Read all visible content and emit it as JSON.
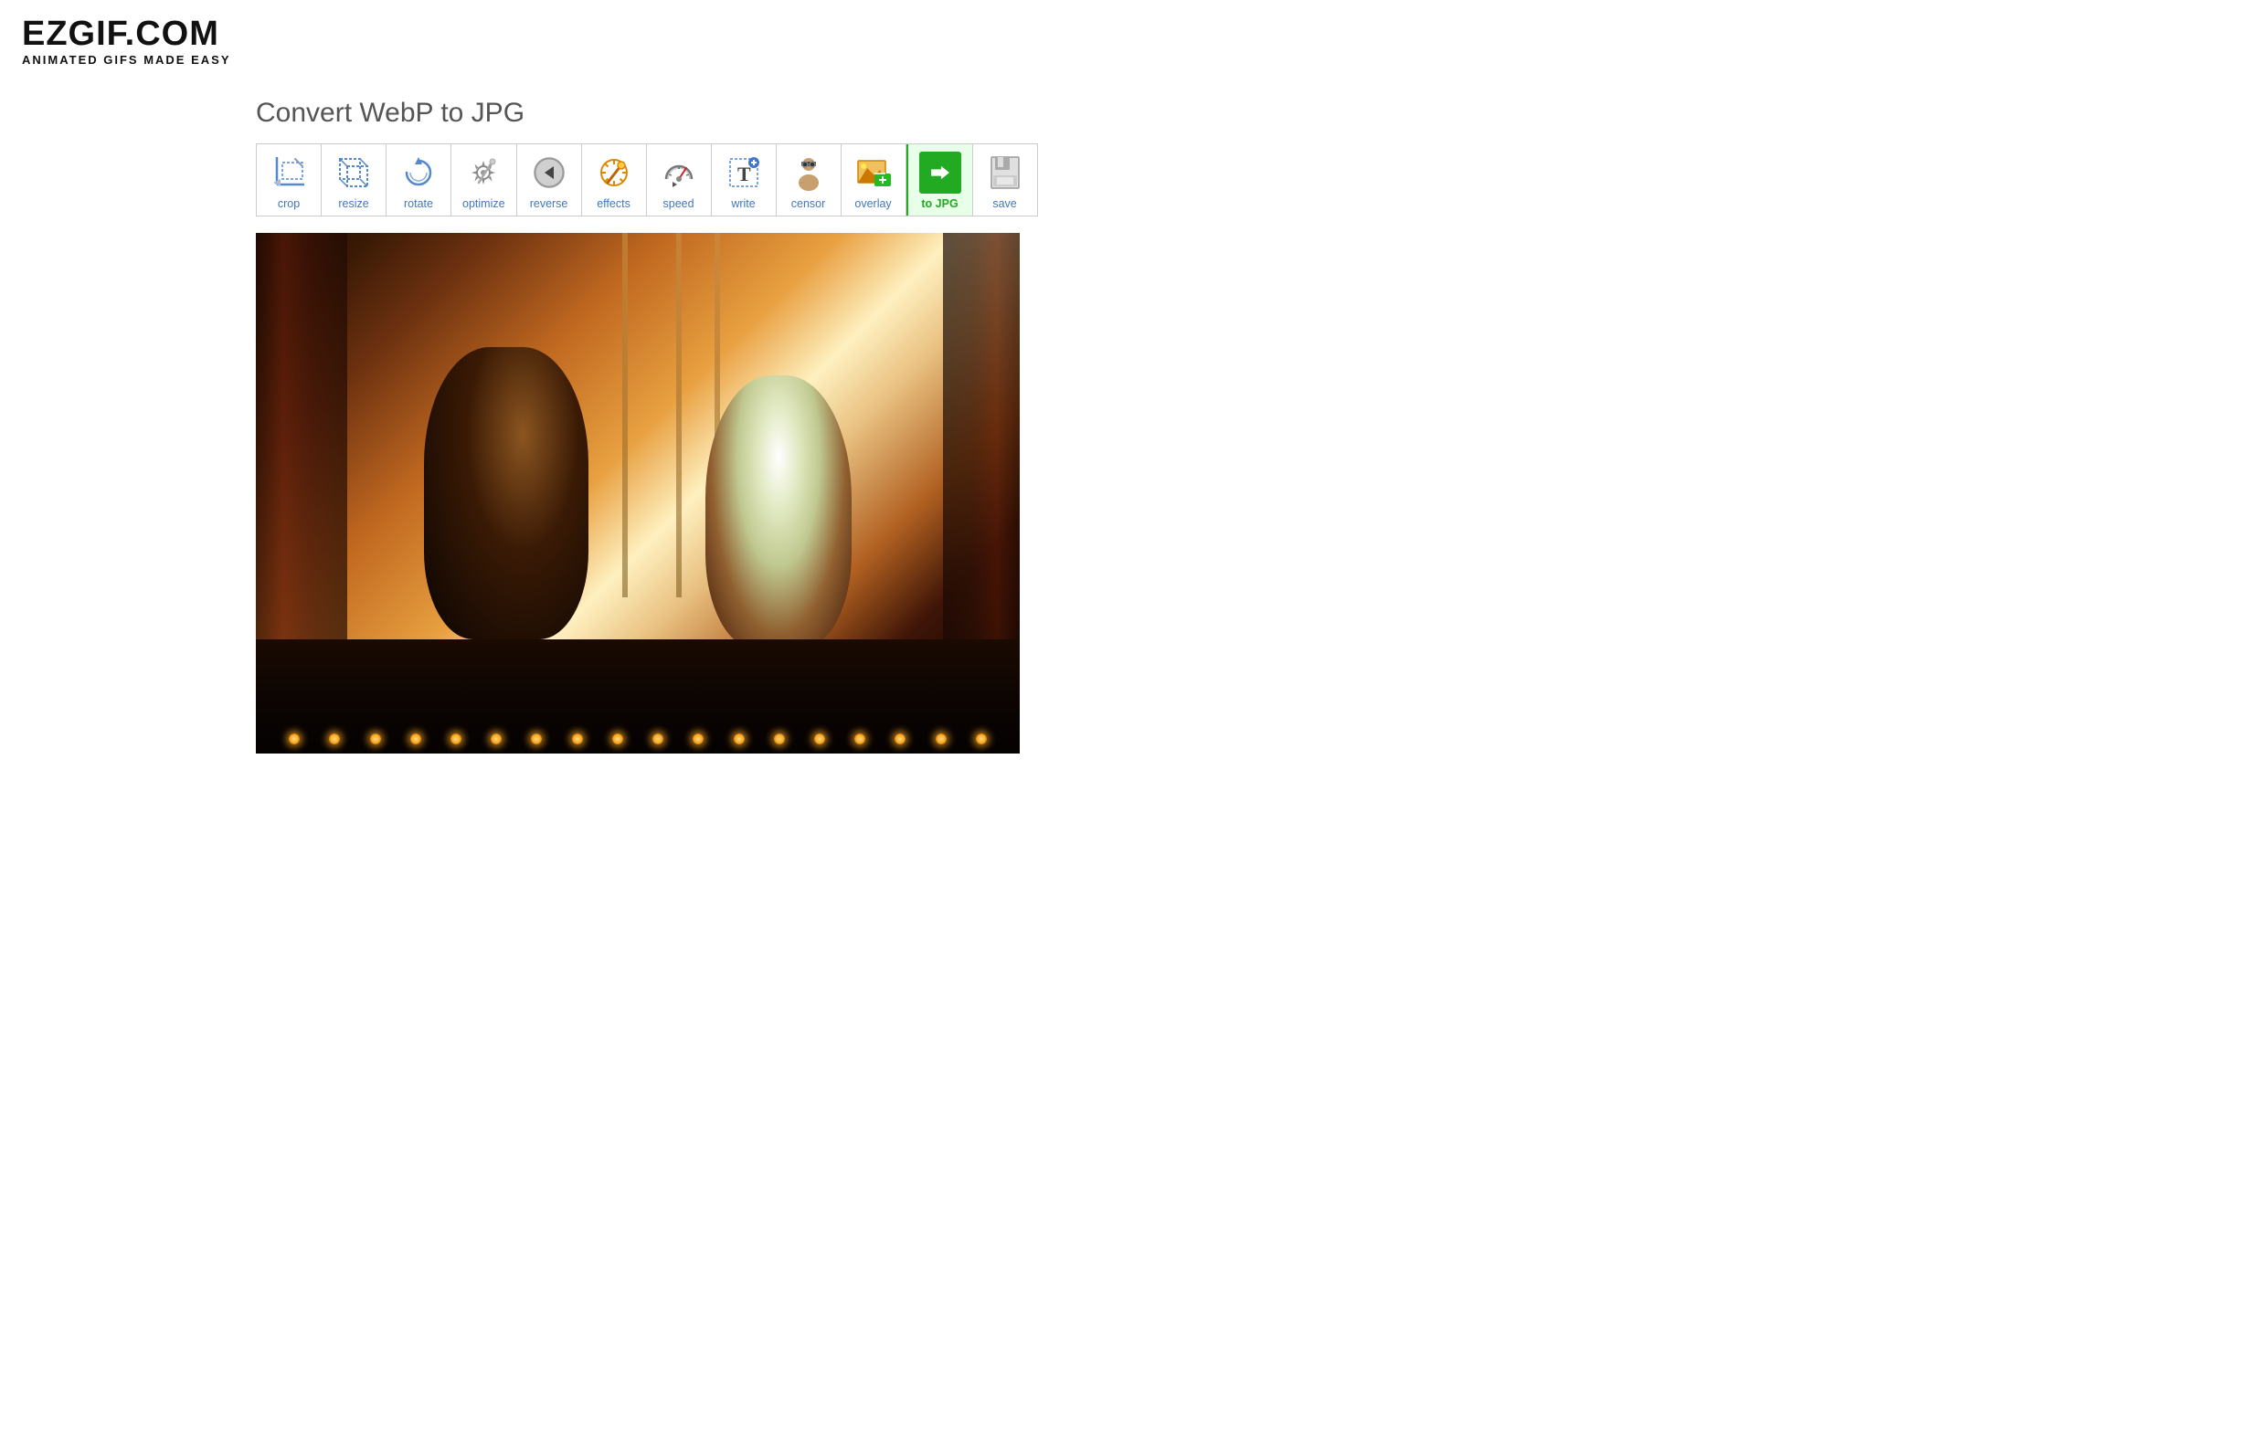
{
  "logo": {
    "main": "EZGIF.COM",
    "sub": "ANIMATED GIFS MADE EASY"
  },
  "page": {
    "title": "Convert WebP to JPG"
  },
  "toolbar": {
    "tools": [
      {
        "id": "crop",
        "label": "crop",
        "icon": "crop",
        "active": false
      },
      {
        "id": "resize",
        "label": "resize",
        "icon": "resize",
        "active": false
      },
      {
        "id": "rotate",
        "label": "rotate",
        "icon": "rotate",
        "active": false
      },
      {
        "id": "optimize",
        "label": "optimize",
        "icon": "optimize",
        "active": false
      },
      {
        "id": "reverse",
        "label": "reverse",
        "icon": "reverse",
        "active": false
      },
      {
        "id": "effects",
        "label": "effects",
        "icon": "effects",
        "active": false
      },
      {
        "id": "speed",
        "label": "speed",
        "icon": "speed",
        "active": false
      },
      {
        "id": "write",
        "label": "write",
        "icon": "write",
        "active": false
      },
      {
        "id": "censor",
        "label": "censor",
        "icon": "censor",
        "active": false
      },
      {
        "id": "overlay",
        "label": "overlay",
        "icon": "overlay",
        "active": false
      },
      {
        "id": "tojpg",
        "label": "to JPG",
        "icon": "tojpg",
        "active": true
      },
      {
        "id": "save",
        "label": "save",
        "icon": "save",
        "active": false
      }
    ]
  }
}
